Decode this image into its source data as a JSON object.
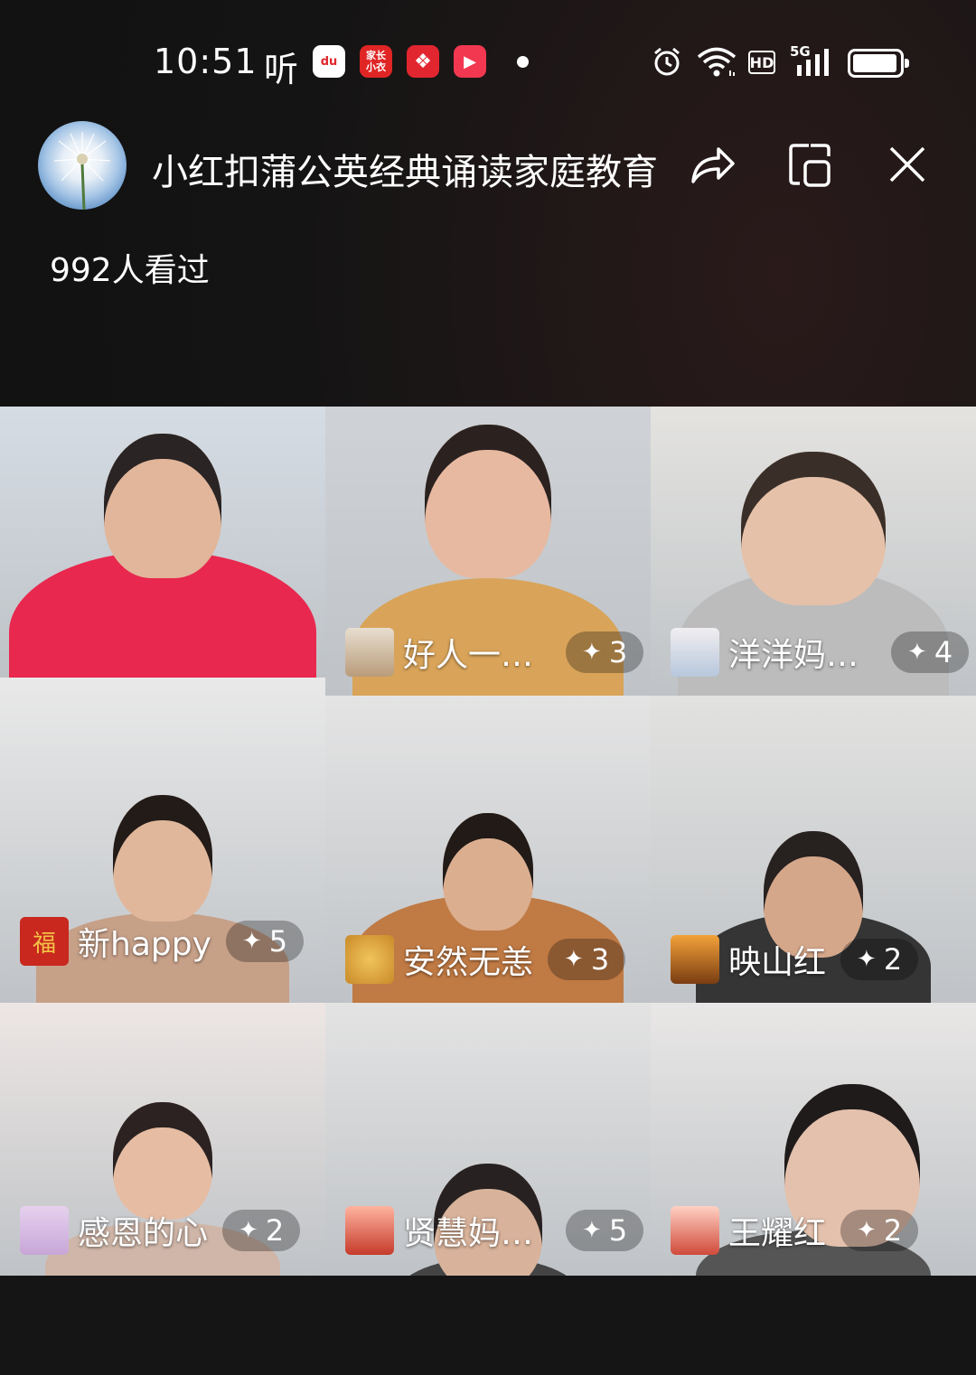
{
  "status": {
    "time": "10:51",
    "ting": "听",
    "app_icons": [
      {
        "name": "baidu-icon",
        "text": "du",
        "color": "#ffffff",
        "fg": "#e0262b"
      },
      {
        "name": "jiazhang-icon",
        "text": "家长\n小衣",
        "color": "#e02525",
        "fg": "#ffffff"
      },
      {
        "name": "pinduoduo-icon",
        "text": "❖",
        "color": "#e22630",
        "fg": "#ffffff"
      },
      {
        "name": "video-play-icon",
        "text": "▶",
        "color": "#f23850",
        "fg": "#ffffff"
      }
    ],
    "hd": "HD",
    "network": "5G",
    "battery_level": 0.95
  },
  "header": {
    "title": "小红扣蒲公英经典诵读家庭教育",
    "viewers": "992人看过"
  },
  "participants": [
    {
      "name": "",
      "count": "",
      "colors": {
        "bg": "#d5dce4",
        "skin": "#e1b69a",
        "hair": "#2a2424",
        "shirt": "#e8284e"
      }
    },
    {
      "name": "好人一…",
      "count": "3",
      "colors": {
        "bg": "#cfd2d6",
        "skin": "#e7b9a0",
        "hair": "#2b2220",
        "shirt": "#d9a45a"
      }
    },
    {
      "name": "洋洋妈…",
      "count": "4",
      "colors": {
        "bg": "#e4e3e0",
        "skin": "#e6c1aa",
        "hair": "#3a2f28",
        "shirt": "#bcbcbc"
      }
    },
    {
      "name": "新happy",
      "count": "5",
      "colors": {
        "bg": "#e9e9e9",
        "skin": "#e0b79b",
        "hair": "#231b18",
        "shirt": "#c7a088"
      }
    },
    {
      "name": "安然无恙",
      "count": "3",
      "colors": {
        "bg": "#e4e4e4",
        "skin": "#dcae90",
        "hair": "#211a17",
        "shirt": "#c07a44"
      }
    },
    {
      "name": "映山红",
      "count": "2",
      "colors": {
        "bg": "#e2e2e0",
        "skin": "#d5a78a",
        "hair": "#272120",
        "shirt": "#353535"
      }
    },
    {
      "name": "感恩的心",
      "count": "2",
      "colors": {
        "bg": "#ede6e4",
        "skin": "#e6bca3",
        "hair": "#2b2221",
        "shirt": "#cfb6a8"
      }
    },
    {
      "name": "贤慧妈…",
      "count": "5",
      "colors": {
        "bg": "#e3e3e3",
        "skin": "#d8b29a",
        "hair": "#272221",
        "shirt": "#444444"
      }
    },
    {
      "name": "王耀红",
      "count": "2",
      "colors": {
        "bg": "#e9e7e6",
        "skin": "#e4c1ad",
        "hair": "#1f1b1b",
        "shirt": "#555555"
      }
    }
  ]
}
